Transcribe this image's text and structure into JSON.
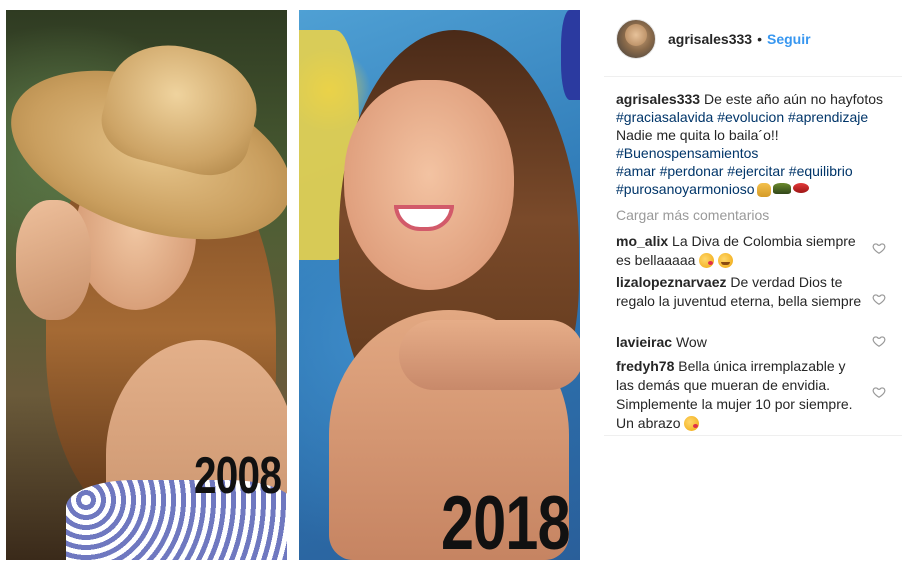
{
  "post": {
    "images": [
      {
        "year_label": "2008"
      },
      {
        "year_label": "2018"
      }
    ]
  },
  "header": {
    "username": "agrisales333",
    "separator": "•",
    "follow_label": "Seguir"
  },
  "caption": {
    "username": "agrisales333",
    "text_1": "De este año aún no hayfotos",
    "tags_1": [
      "#graciasalavida",
      "#evolucion",
      "#aprendizaje"
    ],
    "text_2": "Nadie me quita lo baila´o!!",
    "tags_2": [
      "#Buenospensamientos"
    ],
    "tags_3": [
      "#amar",
      "#perdonar",
      "#ejercitar",
      "#equilibrio"
    ],
    "tags_4": [
      "#purosanoyarmonioso"
    ],
    "emojis": [
      "pray-emoji",
      "car-emoji",
      "lips-emoji"
    ]
  },
  "load_more_label": "Cargar más comentarios",
  "comments": [
    {
      "user": "mo_alix",
      "text": "La Diva de Colombia siempre es bellaaaaa",
      "emojis": [
        "kiss-emoji",
        "blush-emoji"
      ]
    },
    {
      "user": "lizalopeznarvaez",
      "text": "De verdad Dios te regalo la juventud eterna, bella siempre",
      "emojis": []
    },
    {
      "user": "lavieirac",
      "text": "Wow",
      "emojis": []
    },
    {
      "user": "fredyh78",
      "text": "Bella única irremplazable y las demás que mueran de envidia. Simplemente la mujer 10 por siempre. Un abrazo",
      "emojis": [
        "kiss-emoji"
      ]
    }
  ],
  "colors": {
    "link": "#3897f0",
    "hashtag": "#003569",
    "muted": "#999999",
    "text": "#262626"
  }
}
